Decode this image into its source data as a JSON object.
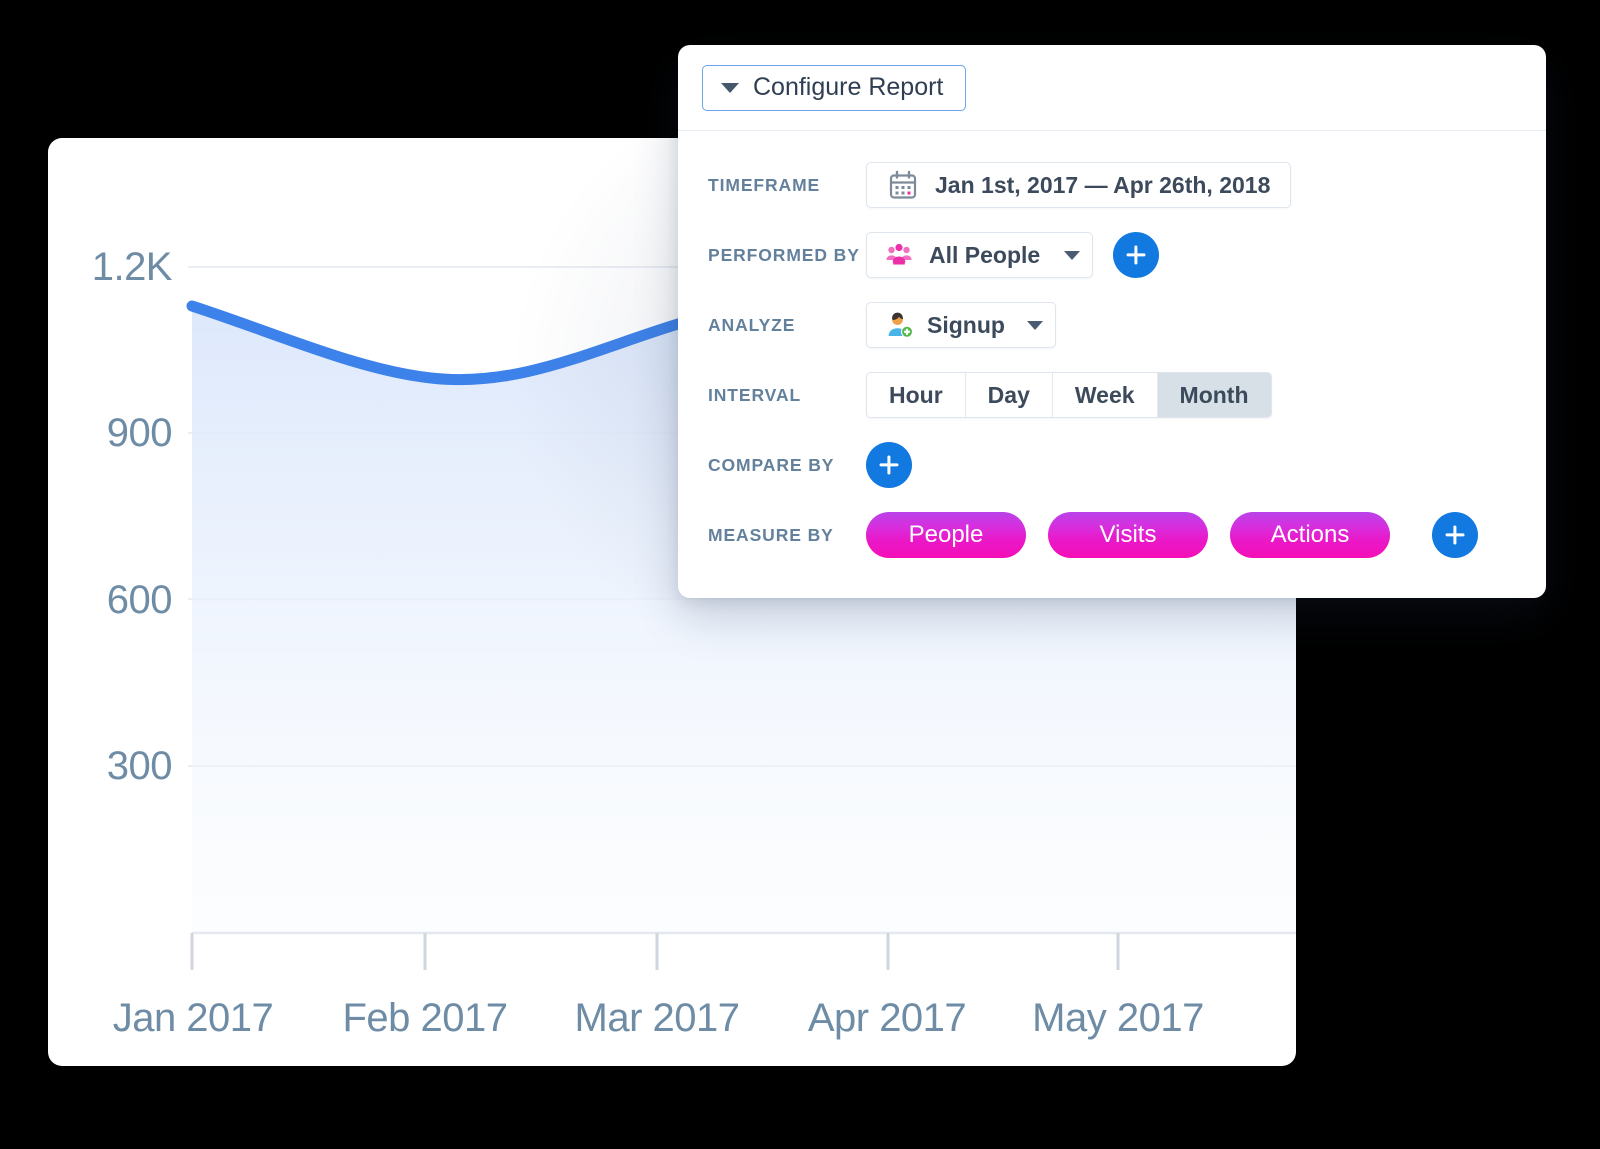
{
  "panel": {
    "configure_button": {
      "label": "Configure Report",
      "caret_icon": "caret-down-icon"
    },
    "rows": {
      "timeframe": {
        "label": "TIMEFRAME",
        "value": "Jan 1st, 2017 — Apr 26th, 2018",
        "icon": "calendar-icon"
      },
      "performed_by": {
        "label": "PERFORMED BY",
        "value": "All People",
        "icon": "people-group-icon",
        "add_label": "+"
      },
      "analyze": {
        "label": "ANALYZE",
        "value": "Signup",
        "icon": "person-add-icon"
      },
      "interval": {
        "label": "INTERVAL",
        "options": [
          "Hour",
          "Day",
          "Week",
          "Month"
        ],
        "selected": "Month"
      },
      "compare_by": {
        "label": "COMPARE BY",
        "add_label": "+"
      },
      "measure_by": {
        "label": "MEASURE BY",
        "pills": [
          "People",
          "Visits",
          "Actions"
        ],
        "add_label": "+"
      }
    }
  },
  "colors": {
    "accent_blue": "#1279e0",
    "line_blue": "#3d82ea",
    "pill_pink_start": "#b843e8",
    "pill_pink_end": "#f40fb6",
    "label_slate": "#63819c",
    "axis_text": "#6e8ca5",
    "segment_active_bg": "#d7dfe7"
  },
  "chart_data": {
    "type": "area",
    "title": "",
    "xlabel": "",
    "ylabel": "",
    "categories": [
      "Jan 2017",
      "Feb 2017",
      "Mar 2017",
      "Apr 2017",
      "May 2017"
    ],
    "x_tick_labels": [
      "Jan 2017",
      "Feb 2017",
      "Mar 2017",
      "Apr 2017",
      "May 2017"
    ],
    "y_tick_labels": [
      "1.2K",
      "900",
      "600",
      "300"
    ],
    "y_tick_values": [
      1200,
      900,
      600,
      300
    ],
    "ylim": [
      0,
      1320
    ],
    "grid": true,
    "legend": null,
    "series": [
      {
        "name": "Signup",
        "values": [
          1130,
          1012,
          1088,
          1078,
          1090
        ]
      }
    ]
  }
}
